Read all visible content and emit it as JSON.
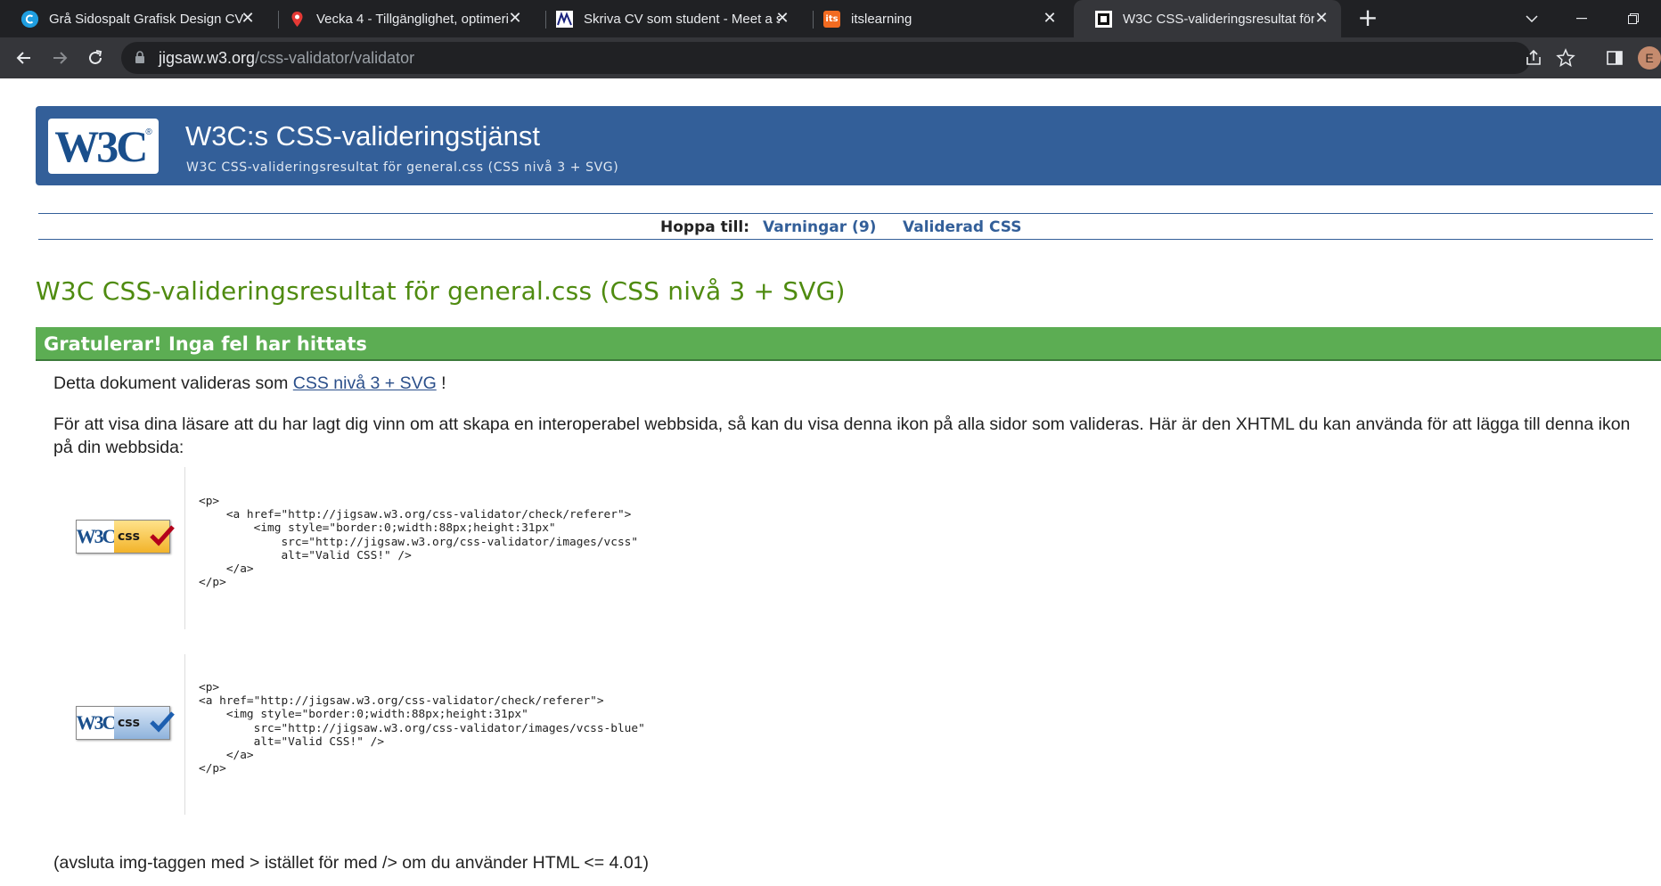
{
  "browser": {
    "tabs": [
      {
        "title": "Grå Sidospalt Grafisk Design CV -",
        "favicon": "canva-icon",
        "active": false
      },
      {
        "title": "Vecka 4 - Tillgänglighet, optimeri",
        "favicon": "map-pin-icon",
        "active": false
      },
      {
        "title": "Skriva CV som student - Meet a s",
        "favicon": "meetas-icon",
        "active": false
      },
      {
        "title": "itslearning",
        "favicon": "itslearning-icon",
        "favicon_text": "its",
        "active": false
      },
      {
        "title": "W3C CSS-valideringsresultat för",
        "favicon": "w3c-icon",
        "active": true
      }
    ],
    "url_host": "jigsaw.w3.org",
    "url_path": "/css-validator/validator",
    "profile_initial": "E"
  },
  "header": {
    "logo_text": "W3C",
    "logo_reg": "®",
    "title": "W3C:s CSS-valideringstjänst",
    "subtitle": "W3C CSS-valideringsresultat för general.css (CSS nivå 3 + SVG)"
  },
  "jump": {
    "label": "Hoppa till:",
    "warnings_link": "Varningar (9)",
    "validated_link": "Validerad CSS"
  },
  "result": {
    "heading": "W3C CSS-valideringsresultat för general.css (CSS nivå 3 + SVG)",
    "congrats": "Gratulerar! Inga fel har hittats",
    "validated_prefix": "Detta dokument valideras som",
    "validated_link": "CSS nivå 3 + SVG",
    "validated_suffix": "!",
    "icon_text": "För att visa dina läsare att du har lagt dig vinn om att skapa en interoperabel webbsida, så kan du visa denna ikon på alla sidor som valideras. Här är den XHTML du kan använda för att lägga till denna ikon på din webbsida:",
    "badges": [
      {
        "w3c": "W3C",
        "css": "css",
        "variant": "gold",
        "code": "<p>\n    <a href=\"http://jigsaw.w3.org/css-validator/check/referer\">\n        <img style=\"border:0;width:88px;height:31px\"\n            src=\"http://jigsaw.w3.org/css-validator/images/vcss\"\n            alt=\"Valid CSS!\" />\n    </a>\n</p>"
      },
      {
        "w3c": "W3C",
        "css": "css",
        "variant": "blue",
        "code": "<p>\n<a href=\"http://jigsaw.w3.org/css-validator/check/referer\">\n    <img style=\"border:0;width:88px;height:31px\"\n        src=\"http://jigsaw.w3.org/css-validator/images/vcss-blue\"\n        alt=\"Valid CSS!\" />\n    </a>\n</p>"
      }
    ],
    "footnote": "(avsluta img-taggen med > istället för med /> om du använder HTML <= 4.01)"
  },
  "colors": {
    "banner": "#335f99",
    "heading_green": "#4f8b10",
    "congrats_green": "#5cad53"
  }
}
